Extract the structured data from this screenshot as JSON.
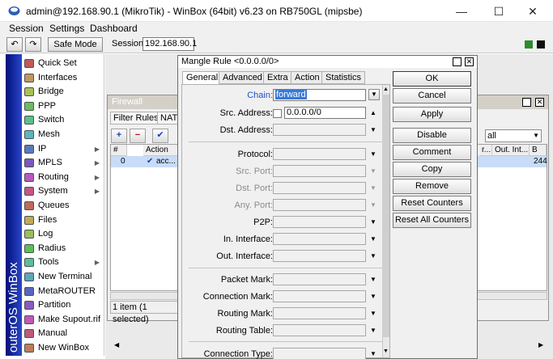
{
  "window": {
    "title": "admin@192.168.90.1 (MikroTik) - WinBox (64bit) v6.23 on RB750GL (mipsbe)",
    "minimize": "—",
    "maximize": "☐",
    "close": "✕"
  },
  "menu": {
    "items": [
      "Session",
      "Settings",
      "Dashboard"
    ]
  },
  "toolbar": {
    "undo": "↶",
    "redo": "↷",
    "safe_mode": "Safe Mode",
    "session_label": "Session:",
    "session_value": "192.168.90.1"
  },
  "colors": {
    "status_green": "#2e8b2e",
    "status_black": "#101010",
    "band_start": "#000f7a",
    "band_end": "#2a46c8",
    "chain_selection": "#3a78d8",
    "row_highlight": "#c8dcf8"
  },
  "sidebar": {
    "band_text": "outerOS WinBox",
    "items": [
      {
        "label": "Quick Set",
        "icon": "quick-set-icon",
        "submenu": false
      },
      {
        "label": "Interfaces",
        "icon": "interfaces-icon",
        "submenu": false
      },
      {
        "label": "Bridge",
        "icon": "bridge-icon",
        "submenu": false
      },
      {
        "label": "PPP",
        "icon": "ppp-icon",
        "submenu": false
      },
      {
        "label": "Switch",
        "icon": "switch-icon",
        "submenu": false
      },
      {
        "label": "Mesh",
        "icon": "mesh-icon",
        "submenu": false
      },
      {
        "label": "IP",
        "icon": "ip-icon",
        "submenu": true
      },
      {
        "label": "MPLS",
        "icon": "mpls-icon",
        "submenu": true
      },
      {
        "label": "Routing",
        "icon": "routing-icon",
        "submenu": true
      },
      {
        "label": "System",
        "icon": "system-icon",
        "submenu": true
      },
      {
        "label": "Queues",
        "icon": "queues-icon",
        "submenu": false
      },
      {
        "label": "Files",
        "icon": "files-icon",
        "submenu": false
      },
      {
        "label": "Log",
        "icon": "log-icon",
        "submenu": false
      },
      {
        "label": "Radius",
        "icon": "radius-icon",
        "submenu": false
      },
      {
        "label": "Tools",
        "icon": "tools-icon",
        "submenu": true
      },
      {
        "label": "New Terminal",
        "icon": "terminal-icon",
        "submenu": false
      },
      {
        "label": "MetaROUTER",
        "icon": "metarouter-icon",
        "submenu": false
      },
      {
        "label": "Partition",
        "icon": "partition-icon",
        "submenu": false
      },
      {
        "label": "Make Supout.rif",
        "icon": "supout-icon",
        "submenu": false
      },
      {
        "label": "Manual",
        "icon": "manual-icon",
        "submenu": false
      },
      {
        "label": "New WinBox",
        "icon": "new-winbox-icon",
        "submenu": false
      }
    ]
  },
  "firewall": {
    "title": "Firewall",
    "tabs": [
      "Filter Rules",
      "NAT"
    ],
    "tool_add": "+",
    "tool_remove": "−",
    "tool_enable": "✔",
    "filter_value": "all",
    "columns": [
      "#",
      "Action",
      "r...",
      "Out. Int...",
      "B"
    ],
    "rows": [
      {
        "num": "0",
        "action": "acc...",
        "bytes": "244"
      }
    ],
    "status": "1 item (1 selected)"
  },
  "dialog": {
    "title": "Mangle Rule <0.0.0.0/0>",
    "tabs": [
      "General",
      "Advanced",
      "Extra",
      "Action",
      "Statistics"
    ],
    "fields": {
      "chain_label": "Chain:",
      "chain_value": "forward",
      "src_address_label": "Src. Address:",
      "src_address_value": "0.0.0.0/0",
      "dst_address_label": "Dst. Address:",
      "protocol_label": "Protocol:",
      "src_port_label": "Src. Port:",
      "dst_port_label": "Dst. Port:",
      "any_port_label": "Any. Port:",
      "p2p_label": "P2P:",
      "in_interface_label": "In. Interface:",
      "out_interface_label": "Out. Interface:",
      "packet_mark_label": "Packet Mark:",
      "connection_mark_label": "Connection Mark:",
      "routing_mark_label": "Routing Mark:",
      "routing_table_label": "Routing Table:",
      "connection_type_label": "Connection Type:"
    },
    "buttons": [
      "OK",
      "Cancel",
      "Apply",
      "Disable",
      "Comment",
      "Copy",
      "Remove",
      "Reset Counters",
      "Reset All Counters"
    ]
  }
}
